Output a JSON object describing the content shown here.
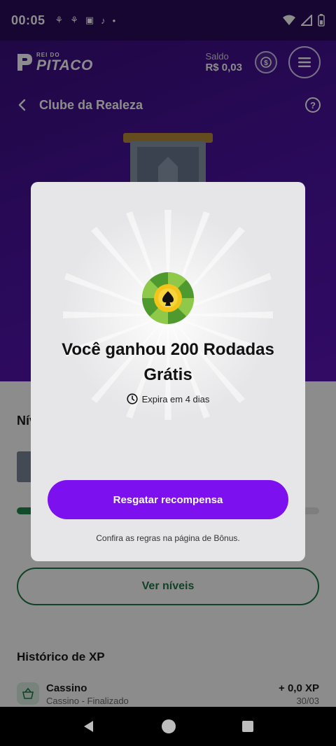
{
  "status_bar": {
    "time": "00:05",
    "notification_icons": [
      "app-icon",
      "app-icon",
      "camera-icon",
      "tiktok-icon",
      "dot-icon"
    ],
    "system_icons": [
      "wifi-icon",
      "signal-icon",
      "battery-icon"
    ]
  },
  "header": {
    "logo_small": "REI DO",
    "logo_big": "PITACO",
    "balance_label": "Saldo",
    "balance_value": "R$ 0,03"
  },
  "subnav": {
    "title": "Clube da Realeza",
    "help_symbol": "?"
  },
  "background_content": {
    "levels_title": "Nív",
    "levels_button": "Ver níveis",
    "history_title": "Histórico de XP",
    "history_item": {
      "title": "Cassino",
      "subtitle": "Cassino - Finalizado",
      "xp": "+ 0,0 XP",
      "date": "30/03"
    }
  },
  "modal": {
    "title": "Você ganhou 200 Rodadas Grátis",
    "expiry": "Expira em 4 dias",
    "claim_button": "Resgatar recompensa",
    "rules": "Confira as regras na página de Bônus."
  },
  "colors": {
    "brand_purple": "#7c10ef",
    "header_purple": "#4a12a0",
    "green": "#1e7a45"
  }
}
